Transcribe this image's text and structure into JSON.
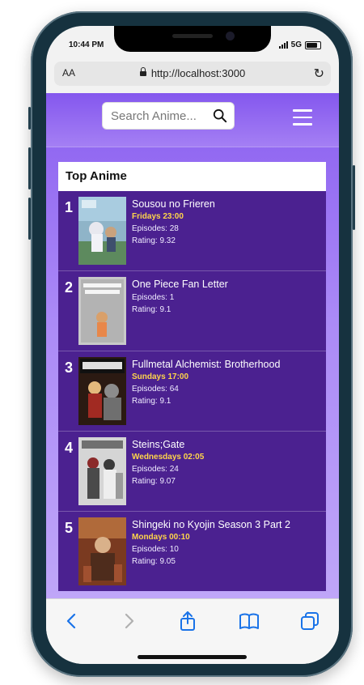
{
  "status": {
    "time": "10:44 PM",
    "network": "5G"
  },
  "browser": {
    "text_size_label": "AA",
    "url": "http://localhost:3000"
  },
  "search": {
    "placeholder": "Search Anime..."
  },
  "list": {
    "title": "Top Anime",
    "items": [
      {
        "rank": "1",
        "title": "Sousou no Frieren",
        "airtime": "Fridays 23:00",
        "episodes": "Episodes: 28",
        "rating": "Rating: 9.32"
      },
      {
        "rank": "2",
        "title": "One Piece Fan Letter",
        "airtime": "",
        "episodes": "Episodes: 1",
        "rating": "Rating: 9.1"
      },
      {
        "rank": "3",
        "title": "Fullmetal Alchemist: Brotherhood",
        "airtime": "Sundays 17:00",
        "episodes": "Episodes: 64",
        "rating": "Rating: 9.1"
      },
      {
        "rank": "4",
        "title": "Steins;Gate",
        "airtime": "Wednesdays 02:05",
        "episodes": "Episodes: 24",
        "rating": "Rating: 9.07"
      },
      {
        "rank": "5",
        "title": "Shingeki no Kyojin Season 3 Part 2",
        "airtime": "Mondays 00:10",
        "episodes": "Episodes: 10",
        "rating": "Rating: 9.05"
      }
    ]
  },
  "icons": {
    "toolbar": [
      "back-icon",
      "forward-icon",
      "share-icon",
      "bookmarks-icon",
      "tabs-icon"
    ],
    "header": [
      "search-icon",
      "menu-icon"
    ]
  },
  "colors": {
    "header": "#8457ee",
    "card": "#4b2190",
    "airtime": "#ffd54a",
    "toolbar_icon": "#1a73e8",
    "toolbar_icon_disabled": "#b0b0b0"
  }
}
